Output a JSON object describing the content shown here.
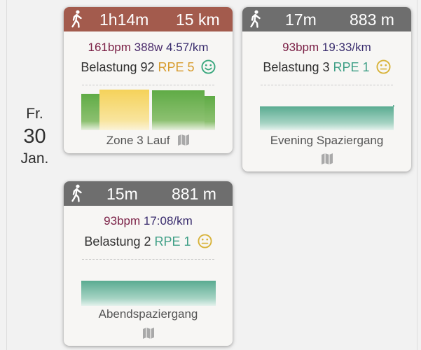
{
  "date": {
    "weekday": "Fr.",
    "day": "30",
    "month": "Jan."
  },
  "colors": {
    "header_run": "#a35b4d",
    "header_walk": "#6e6e6e",
    "bpm": "#7a1f45",
    "rpe_high": "#d79b2c",
    "rpe_low": "#3f9f86",
    "face_green": "#3aa87e",
    "face_yellow": "#d8b33a",
    "zone_green": "#6ab04c",
    "zone_yellow": "#f5d66a",
    "walk_bar": "#6ab7a0"
  },
  "cards": [
    {
      "icon": "walking-icon",
      "duration": "1h14m",
      "distance": "15 km",
      "bpm": "161bpm",
      "watts": "388w",
      "pace": "4:57/km",
      "load_label": "Belastung 92",
      "rpe": "RPE 5",
      "face": "smiley-happy-icon",
      "title": "Zone 3 Lauf",
      "map_icon": "map-icon"
    },
    {
      "icon": "walking-icon",
      "duration": "17m",
      "distance": "883 m",
      "bpm": "93bpm",
      "pace": "19:33/km",
      "load_label": "Belastung 3",
      "rpe": "RPE 1",
      "face": "smiley-neutral-icon",
      "title": "Evening Spaziergang",
      "map_icon": "map-icon"
    },
    {
      "icon": "walking-icon",
      "duration": "15m",
      "distance": "881 m",
      "bpm": "93bpm",
      "pace": "17:08/km",
      "load_label": "Belastung 2",
      "rpe": "RPE 1",
      "face": "smiley-neutral-icon",
      "title": "Abendspaziergang",
      "map_icon": "map-icon"
    }
  ]
}
